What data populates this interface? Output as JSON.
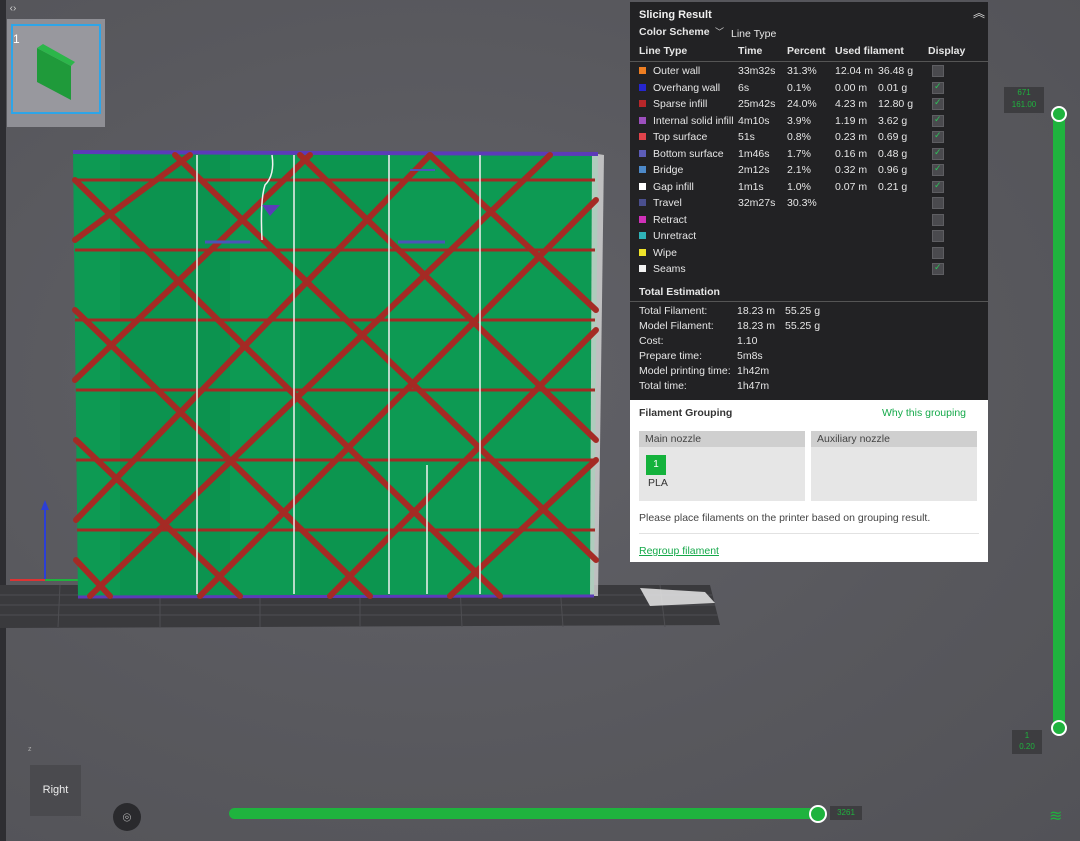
{
  "app": {
    "plate_number": "1",
    "view_label": "Right",
    "axis_small": "z"
  },
  "slicing_result": {
    "title": "Slicing Result",
    "color_scheme_label": "Color Scheme",
    "color_scheme_value": "Line Type",
    "headers": [
      "Line Type",
      "Time",
      "Percent",
      "Used filament",
      "Display"
    ],
    "rows": [
      {
        "name": "Outer wall",
        "color": "#ee7e22",
        "time": "33m32s",
        "percent": "31.3%",
        "length": "12.04 m",
        "weight": "36.48 g",
        "display": false
      },
      {
        "name": "Overhang wall",
        "color": "#2626cf",
        "time": "6s",
        "percent": "0.1%",
        "length": "0.00 m",
        "weight": "0.01 g",
        "display": true
      },
      {
        "name": "Sparse infill",
        "color": "#b8272a",
        "time": "25m42s",
        "percent": "24.0%",
        "length": "4.23 m",
        "weight": "12.80 g",
        "display": true
      },
      {
        "name": "Internal solid infill",
        "color": "#9c4fbd",
        "time": "4m10s",
        "percent": "3.9%",
        "length": "1.19 m",
        "weight": "3.62 g",
        "display": true
      },
      {
        "name": "Top surface",
        "color": "#e0434b",
        "time": "51s",
        "percent": "0.8%",
        "length": "0.23 m",
        "weight": "0.69 g",
        "display": true
      },
      {
        "name": "Bottom surface",
        "color": "#5c5cb8",
        "time": "1m46s",
        "percent": "1.7%",
        "length": "0.16 m",
        "weight": "0.48 g",
        "display": true
      },
      {
        "name": "Bridge",
        "color": "#4d89c9",
        "time": "2m12s",
        "percent": "2.1%",
        "length": "0.32 m",
        "weight": "0.96 g",
        "display": true
      },
      {
        "name": "Gap infill",
        "color": "#ffffff",
        "time": "1m1s",
        "percent": "1.0%",
        "length": "0.07 m",
        "weight": "0.21 g",
        "display": true
      },
      {
        "name": "Travel",
        "color": "#4a4f8e",
        "time": "32m27s",
        "percent": "30.3%",
        "length": "",
        "weight": "",
        "display": false
      },
      {
        "name": "Retract",
        "color": "#d031b9",
        "time": "",
        "percent": "",
        "length": "",
        "weight": "",
        "display": false
      },
      {
        "name": "Unretract",
        "color": "#2fb3b8",
        "time": "",
        "percent": "",
        "length": "",
        "weight": "",
        "display": false
      },
      {
        "name": "Wipe",
        "color": "#efe32a",
        "time": "",
        "percent": "",
        "length": "",
        "weight": "",
        "display": false
      },
      {
        "name": "Seams",
        "color": "#f2f2f2",
        "time": "",
        "percent": "",
        "length": "",
        "weight": "",
        "display": true
      }
    ],
    "total_title": "Total Estimation",
    "totals": [
      {
        "label": "Total Filament:",
        "v1": "18.23 m",
        "v2": "55.25 g"
      },
      {
        "label": "Model Filament:",
        "v1": "18.23 m",
        "v2": "55.25 g"
      },
      {
        "label": "Cost:",
        "v1": "1.10",
        "v2": ""
      },
      {
        "label": "Prepare time:",
        "v1": "5m8s",
        "v2": ""
      },
      {
        "label": "Model printing time:",
        "v1": "1h42m",
        "v2": ""
      },
      {
        "label": "Total time:",
        "v1": "1h47m",
        "v2": ""
      }
    ]
  },
  "filament_grouping": {
    "title": "Filament Grouping",
    "why_link": "Why this grouping",
    "main_nozzle": "Main nozzle",
    "aux_nozzle": "Auxiliary nozzle",
    "filament_number": "1",
    "filament_type": "PLA",
    "message": "Please place filaments on the printer based on grouping result.",
    "regroup_link": "Regroup filament",
    "accent_color": "#15a94a"
  },
  "sliders": {
    "layer_top": "671\n161.00",
    "layer_bottom": "1\n0.20",
    "horizontal_value": "3261"
  }
}
